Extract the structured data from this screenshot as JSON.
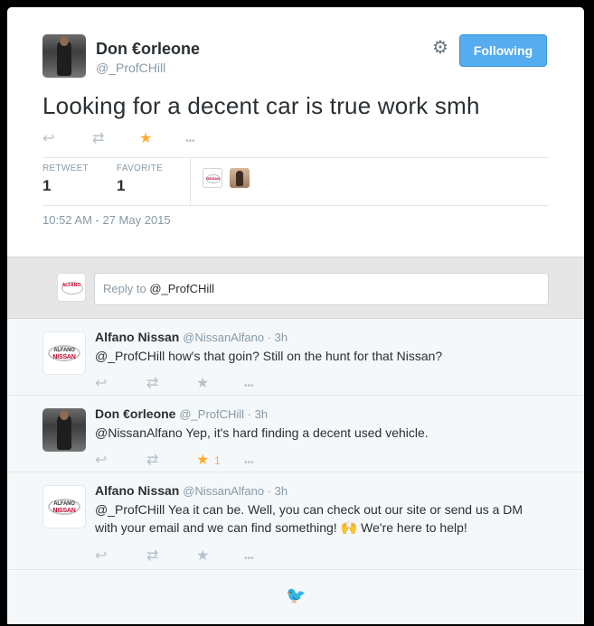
{
  "main": {
    "name": "Don €orleone",
    "handle": "@_ProfCHill",
    "follow_label": "Following",
    "text": "Looking for a decent car is true work smh",
    "retweet_label": "RETWEET",
    "retweet_count": "1",
    "favorite_label": "FAVORITE",
    "favorite_count": "1",
    "timestamp": "10:52 AM - 27 May 2015",
    "actions": {
      "reply": "↩",
      "retweet": "⇄",
      "favorite": "★",
      "more": "•••"
    }
  },
  "reply_box": {
    "prefix": "Reply to ",
    "handle": "@_ProfCHill"
  },
  "replies": [
    {
      "name": "Alfano Nissan",
      "meta": "@NissanAlfano · 3h",
      "text": "@_ProfCHill how's that goin? Still on the hunt for that Nissan?",
      "favorite_count": ""
    },
    {
      "name": "Don €orleone",
      "meta": "@_ProfCHill · 3h",
      "text": "@NissanAlfano Yep, it's hard finding a decent used vehicle.",
      "favorite_count": "1"
    },
    {
      "name": "Alfano Nissan",
      "meta": "@NissanAlfano · 3h",
      "text_line1": "@_ProfCHill Yea it can be. Well, you can check out our site or send us a DM",
      "text_line2a": "with your email and we can find something! ",
      "emoji": "🙌",
      "text_line2b": " We're here to help!",
      "favorite_count": ""
    }
  ],
  "logo_text": {
    "top": "ALFANO",
    "bottom": "NISSAN"
  },
  "colors": {
    "accent": "#55acee",
    "favorite": "#ffac33",
    "muted": "#8899a6",
    "text": "#292f33"
  },
  "icons": {
    "gear": "gear-icon",
    "bird": "twitter-bird-icon"
  }
}
